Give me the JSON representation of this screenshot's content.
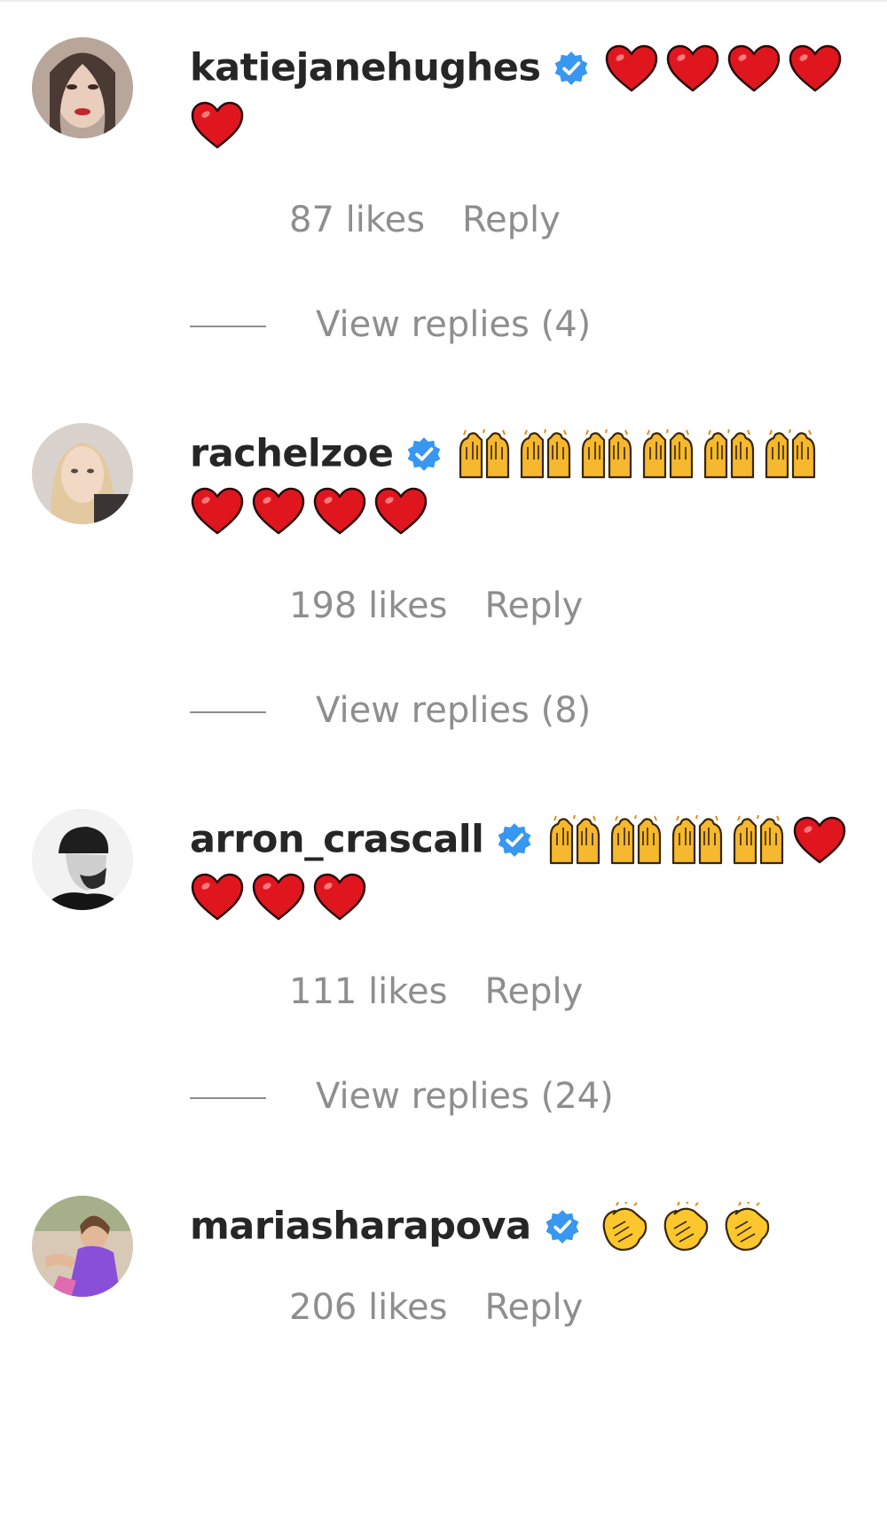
{
  "colors": {
    "username": "#262626",
    "meta": "#8e8e8e",
    "verified": "#3897f0",
    "heart": "#e0161f",
    "raise_hands": "#f5b82e",
    "clap": "#fcc72d"
  },
  "comments": [
    {
      "username": "katiejanehughes",
      "verified": true,
      "emojis": [
        "red-heart",
        "red-heart",
        "red-heart",
        "red-heart",
        "red-heart"
      ],
      "likes": "87 likes",
      "reply_label": "Reply",
      "view_replies": "View replies (4)"
    },
    {
      "username": "rachelzoe",
      "verified": true,
      "emojis": [
        "raising-hands",
        "raising-hands",
        "raising-hands",
        "raising-hands",
        "raising-hands",
        "raising-hands",
        "red-heart",
        "red-heart",
        "red-heart",
        "red-heart"
      ],
      "likes": "198 likes",
      "reply_label": "Reply",
      "view_replies": "View replies (8)"
    },
    {
      "username": "arron_crascall",
      "verified": true,
      "emojis": [
        "raising-hands",
        "raising-hands",
        "raising-hands",
        "raising-hands",
        "red-heart",
        "red-heart",
        "red-heart",
        "red-heart"
      ],
      "likes": "111 likes",
      "reply_label": "Reply",
      "view_replies": "View replies (24)"
    },
    {
      "username": "mariasharapova",
      "verified": true,
      "emojis": [
        "clapping-hands",
        "clapping-hands",
        "clapping-hands"
      ],
      "likes": "206 likes",
      "reply_label": "Reply",
      "view_replies": ""
    }
  ]
}
